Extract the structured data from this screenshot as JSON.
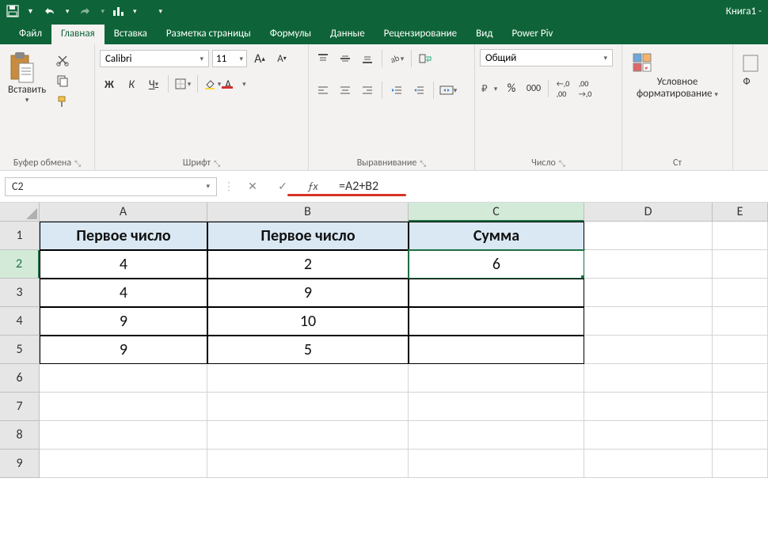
{
  "app": {
    "title": "Книга1 -"
  },
  "tabs": [
    "Файл",
    "Главная",
    "Вставка",
    "Разметка страницы",
    "Формулы",
    "Данные",
    "Рецензирование",
    "Вид",
    "Power Piv"
  ],
  "active_tab_index": 1,
  "ribbon": {
    "clipboard": {
      "paste": "Вставить",
      "label": "Буфер обмена"
    },
    "font": {
      "name": "Calibri",
      "size": "11",
      "inc": "A",
      "dec": "A",
      "bold": "Ж",
      "italic": "К",
      "underline": "Ч",
      "label": "Шрифт"
    },
    "alignment": {
      "label": "Выравнивание"
    },
    "number": {
      "format": "Общий",
      "label": "Число"
    },
    "cond": {
      "line1": "Условное",
      "line2": "форматирование",
      "label": "Ст"
    },
    "extra": {
      "f": "Ф"
    }
  },
  "formula_bar": {
    "namebox": "C2",
    "formula": "=A2+B2"
  },
  "columns": [
    "A",
    "B",
    "C",
    "D",
    "E"
  ],
  "rows": [
    "1",
    "2",
    "3",
    "4",
    "5",
    "6",
    "7",
    "8",
    "9"
  ],
  "active": {
    "col": "C",
    "row": "2"
  },
  "sheet": {
    "headers": [
      "Первое число",
      "Первое число",
      "Сумма"
    ],
    "data": [
      {
        "a": "4",
        "b": "2",
        "c": "6"
      },
      {
        "a": "4",
        "b": "9",
        "c": ""
      },
      {
        "a": "9",
        "b": "10",
        "c": ""
      },
      {
        "a": "9",
        "b": "5",
        "c": ""
      }
    ]
  }
}
